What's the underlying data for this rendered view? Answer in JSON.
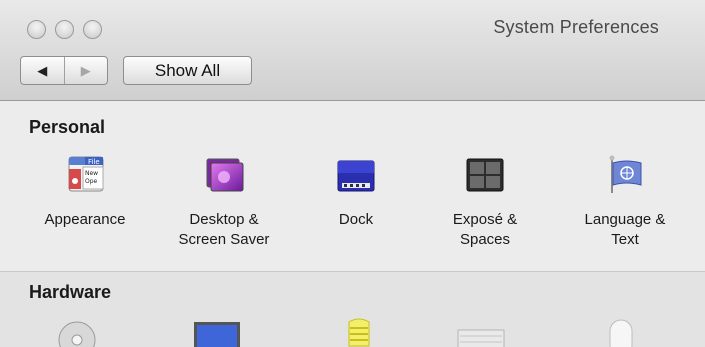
{
  "window": {
    "title": "System Preferences"
  },
  "toolbar": {
    "back_glyph": "◀",
    "forward_glyph": "▶",
    "show_all_label": "Show All"
  },
  "sections": {
    "personal": {
      "title": "Personal",
      "panes": [
        {
          "label": "Appearance",
          "icon": "appearance-icon"
        },
        {
          "label": "Desktop &\nScreen Saver",
          "icon": "desktop-screen-saver-icon"
        },
        {
          "label": "Dock",
          "icon": "dock-icon"
        },
        {
          "label": "Exposé &\nSpaces",
          "icon": "expose-spaces-icon"
        },
        {
          "label": "Language &\nText",
          "icon": "language-text-flag-icon"
        }
      ]
    },
    "hardware": {
      "title": "Hardware",
      "panes": [
        {
          "icon": "cds-dvds-icon"
        },
        {
          "icon": "displays-icon"
        },
        {
          "icon": "energy-saver-bulb-icon"
        },
        {
          "icon": "keyboard-icon"
        },
        {
          "icon": "mouse-icon"
        }
      ]
    }
  }
}
